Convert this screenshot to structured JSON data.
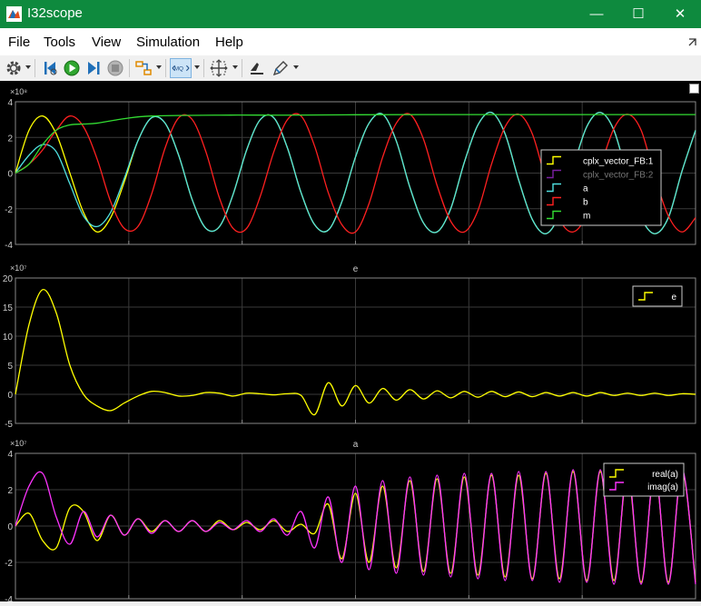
{
  "window": {
    "title": "I32scope",
    "minimize": "—",
    "maximize": "☐",
    "close": "✕"
  },
  "menu": [
    {
      "label": "File"
    },
    {
      "label": "Tools"
    },
    {
      "label": "View"
    },
    {
      "label": "Simulation"
    },
    {
      "label": "Help"
    }
  ],
  "toolbar": [
    "settings-icon",
    "step-back-icon",
    "run-icon",
    "step-forward-icon",
    "stop-icon",
    "highlight-signal-icon",
    "zoom-icon",
    "fit-to-view-icon",
    "cursor-measurements-icon",
    "style-icon"
  ],
  "colors": {
    "yellow": "#ffff00",
    "purple": "#7a1fa2",
    "cyan": "#4fe0e0",
    "red": "#ff2020",
    "green": "#33dd33",
    "magenta": "#ff33ff",
    "grid": "#3a3a3a",
    "axis": "#888888"
  },
  "chart_data": [
    {
      "type": "line",
      "title": "",
      "exponent_label": "×10⁸",
      "ylim": [
        -4,
        4
      ],
      "yticks": [
        4,
        2,
        0,
        -2,
        -4
      ],
      "grid": true,
      "legend_position": "right",
      "series": [
        {
          "name": "cplx_vector_FB:1",
          "color": "#ffff00",
          "x": [
            0,
            0.02,
            0.04,
            0.06,
            0.08,
            0.1,
            0.12,
            0.14,
            0.16,
            0.18,
            0.2,
            0.22,
            0.24,
            0.26,
            0.28,
            0.3,
            0.32,
            0.34,
            0.36,
            0.38,
            0.4,
            0.42,
            0.44,
            0.46,
            0.48,
            0.5,
            0.52,
            0.54,
            0.56,
            0.58,
            0.6,
            0.62,
            0.64,
            0.66,
            0.68,
            0.7,
            0.72,
            0.74,
            0.76,
            0.78,
            0.8,
            0.82,
            0.84,
            0.86,
            0.88,
            0.9,
            0.92,
            0.94,
            0.96,
            0.98,
            1.0
          ],
          "y": [
            0,
            2.4,
            3.2,
            2.2,
            0,
            -2.2,
            -3.3,
            -2.5,
            -0.5,
            1.8,
            3.1,
            2.8,
            1.0,
            -1.5,
            -3.1,
            -3.0,
            -1.2,
            1.3,
            3.0,
            3.1,
            1.4,
            -1.1,
            -2.9,
            -3.2,
            -1.6,
            0.9,
            2.8,
            3.3,
            1.8,
            -0.8,
            -2.8,
            -3.3,
            -2.0,
            0.6,
            2.7,
            3.4,
            2.2,
            -0.4,
            -2.6,
            -3.4,
            -2.3,
            0.3,
            2.6,
            3.4,
            2.4,
            -0.2,
            -2.5,
            -3.4,
            -2.5,
            0.1,
            2.4
          ]
        },
        {
          "name": "cplx_vector_FB:2",
          "color": "#7a1fa2",
          "x": [],
          "y": []
        },
        {
          "name": "a",
          "color": "#4fe0e0",
          "x": [
            0,
            0.02,
            0.04,
            0.06,
            0.08,
            0.1,
            0.12,
            0.14,
            0.16,
            0.18,
            0.2,
            0.22,
            0.24,
            0.26,
            0.28,
            0.3,
            0.32,
            0.34,
            0.36,
            0.38,
            0.4,
            0.42,
            0.44,
            0.46,
            0.48,
            0.5,
            0.52,
            0.54,
            0.56,
            0.58,
            0.6,
            0.62,
            0.64,
            0.66,
            0.68,
            0.7,
            0.72,
            0.74,
            0.76,
            0.78,
            0.8,
            0.82,
            0.84,
            0.86,
            0.88,
            0.9,
            0.92,
            0.94,
            0.96,
            0.98,
            1.0
          ],
          "y": [
            0,
            1.0,
            1.6,
            1.2,
            -0.6,
            -2.4,
            -3.0,
            -2.2,
            -0.3,
            1.8,
            3.1,
            2.8,
            1.0,
            -1.5,
            -3.1,
            -3.0,
            -1.2,
            1.3,
            3.0,
            3.1,
            1.4,
            -1.1,
            -2.9,
            -3.2,
            -1.6,
            0.9,
            2.8,
            3.3,
            1.8,
            -0.8,
            -2.8,
            -3.3,
            -2.0,
            0.6,
            2.7,
            3.4,
            2.2,
            -0.4,
            -2.6,
            -3.4,
            -2.3,
            0.3,
            2.6,
            3.4,
            2.4,
            -0.2,
            -2.5,
            -3.4,
            -2.5,
            0.1,
            2.4
          ]
        },
        {
          "name": "b",
          "color": "#ff2020",
          "x": [
            0,
            0.02,
            0.04,
            0.06,
            0.08,
            0.1,
            0.12,
            0.14,
            0.16,
            0.18,
            0.2,
            0.22,
            0.24,
            0.26,
            0.28,
            0.3,
            0.32,
            0.34,
            0.36,
            0.38,
            0.4,
            0.42,
            0.44,
            0.46,
            0.48,
            0.5,
            0.52,
            0.54,
            0.56,
            0.58,
            0.6,
            0.62,
            0.64,
            0.66,
            0.68,
            0.7,
            0.72,
            0.74,
            0.76,
            0.78,
            0.8,
            0.82,
            0.84,
            0.86,
            0.88,
            0.9,
            0.92,
            0.94,
            0.96,
            0.98,
            1.0
          ],
          "y": [
            0,
            0.5,
            1.3,
            2.4,
            3.2,
            2.6,
            0.8,
            -1.6,
            -3.1,
            -3.0,
            -1.2,
            1.4,
            3.1,
            3.0,
            1.2,
            -1.4,
            -3.1,
            -3.1,
            -1.3,
            1.2,
            3.0,
            3.2,
            1.5,
            -1.1,
            -2.9,
            -3.3,
            -1.7,
            0.9,
            2.8,
            3.3,
            1.9,
            -0.7,
            -2.7,
            -3.3,
            -2.1,
            0.5,
            2.6,
            3.3,
            2.2,
            -0.4,
            -2.6,
            -3.3,
            -2.3,
            0.3,
            2.5,
            3.3,
            2.4,
            -0.2,
            -2.4,
            -3.3,
            -2.5
          ]
        },
        {
          "name": "m",
          "color": "#33dd33",
          "x": [
            0,
            0.02,
            0.04,
            0.06,
            0.08,
            0.1,
            0.12,
            0.16,
            0.2,
            0.3,
            0.4,
            0.5,
            0.6,
            0.7,
            0.8,
            0.9,
            1.0
          ],
          "y": [
            0,
            0.5,
            1.6,
            2.4,
            2.7,
            2.75,
            2.8,
            3.05,
            3.2,
            3.25,
            3.25,
            3.27,
            3.28,
            3.28,
            3.28,
            3.28,
            3.28
          ]
        }
      ]
    },
    {
      "type": "line",
      "title": "e",
      "exponent_label": "×10⁷",
      "ylim": [
        -5,
        20
      ],
      "yticks": [
        20,
        15,
        10,
        5,
        0,
        -5
      ],
      "grid": true,
      "legend_position": "top-right",
      "series": [
        {
          "name": "e",
          "color": "#ffff00",
          "x": [
            0,
            0.02,
            0.04,
            0.06,
            0.08,
            0.1,
            0.12,
            0.14,
            0.16,
            0.18,
            0.2,
            0.22,
            0.24,
            0.26,
            0.28,
            0.3,
            0.32,
            0.34,
            0.36,
            0.38,
            0.4,
            0.42,
            0.44,
            0.46,
            0.48,
            0.5,
            0.52,
            0.54,
            0.56,
            0.58,
            0.6,
            0.62,
            0.64,
            0.66,
            0.68,
            0.7,
            0.72,
            0.74,
            0.76,
            0.78,
            0.8,
            0.82,
            0.84,
            0.86,
            0.88,
            0.9,
            0.92,
            0.94,
            0.96,
            0.98,
            1.0
          ],
          "y": [
            0,
            12,
            18,
            14,
            5,
            0,
            -2,
            -2.8,
            -1.5,
            -0.3,
            0.5,
            0.3,
            -0.3,
            -0.2,
            0.3,
            0.2,
            -0.3,
            0.2,
            0.1,
            -0.1,
            0.1,
            -0.2,
            -3.5,
            2,
            -2,
            1.5,
            -1.5,
            1,
            -1,
            0.8,
            -0.8,
            0.6,
            -0.6,
            0.5,
            -0.5,
            0.5,
            -0.4,
            0.4,
            -0.4,
            0.3,
            -0.3,
            0.3,
            -0.3,
            0.3,
            -0.2,
            0.2,
            -0.2,
            0.2,
            -0.2,
            0.1,
            0
          ]
        }
      ]
    },
    {
      "type": "line",
      "title": "a",
      "exponent_label": "×10⁷",
      "ylim": [
        -4,
        4
      ],
      "yticks": [
        4,
        2,
        0,
        -2,
        -4
      ],
      "grid": true,
      "legend_position": "top-right",
      "series": [
        {
          "name": "real(a)",
          "color": "#ffff00",
          "x": [
            0,
            0.02,
            0.04,
            0.06,
            0.08,
            0.1,
            0.12,
            0.14,
            0.16,
            0.18,
            0.2,
            0.22,
            0.24,
            0.26,
            0.28,
            0.3,
            0.32,
            0.34,
            0.36,
            0.38,
            0.4,
            0.42,
            0.44,
            0.46,
            0.48,
            0.5,
            0.52,
            0.54,
            0.56,
            0.58,
            0.6,
            0.62,
            0.64,
            0.66,
            0.68,
            0.7,
            0.72,
            0.74,
            0.76,
            0.78,
            0.8,
            0.82,
            0.84,
            0.86,
            0.88,
            0.9,
            0.92,
            0.94,
            0.96,
            0.98,
            1.0
          ],
          "y": [
            0,
            0.7,
            -0.8,
            -1.2,
            1,
            0.8,
            -0.8,
            0.6,
            -0.5,
            0.4,
            -0.3,
            0.3,
            -0.3,
            0.3,
            -0.3,
            0.3,
            -0.2,
            0.2,
            -0.2,
            0.3,
            -0.3,
            0.1,
            -0.4,
            1.2,
            -1.8,
            1.8,
            -2,
            2.2,
            -2.3,
            2.5,
            -2.5,
            2.6,
            -2.6,
            2.7,
            -2.7,
            2.8,
            -2.8,
            2.8,
            -2.9,
            2.9,
            -2.9,
            3,
            -3,
            3,
            -3,
            3,
            -3.1,
            3.1,
            -3.1,
            3.1,
            -3.1
          ]
        },
        {
          "name": "imag(a)",
          "color": "#ff33ff",
          "x": [
            0,
            0.02,
            0.04,
            0.06,
            0.08,
            0.1,
            0.12,
            0.14,
            0.16,
            0.18,
            0.2,
            0.22,
            0.24,
            0.26,
            0.28,
            0.3,
            0.32,
            0.34,
            0.36,
            0.38,
            0.4,
            0.42,
            0.44,
            0.46,
            0.48,
            0.5,
            0.52,
            0.54,
            0.56,
            0.58,
            0.6,
            0.62,
            0.64,
            0.66,
            0.68,
            0.7,
            0.72,
            0.74,
            0.76,
            0.78,
            0.8,
            0.82,
            0.84,
            0.86,
            0.88,
            0.9,
            0.92,
            0.94,
            0.96,
            0.98,
            1.0
          ],
          "y": [
            0,
            2.2,
            2.9,
            0.5,
            -1,
            0.8,
            -0.6,
            0.6,
            -0.5,
            0.4,
            -0.4,
            0.3,
            -0.3,
            0.3,
            -0.3,
            0.2,
            -0.2,
            0.3,
            -0.3,
            0.4,
            -0.5,
            0.8,
            -1.2,
            1.6,
            -2,
            2.2,
            -2.4,
            2.5,
            -2.6,
            2.7,
            -2.7,
            2.8,
            -2.8,
            2.9,
            -2.9,
            2.9,
            -3,
            3,
            -3,
            3,
            -3.1,
            3.1,
            -3.1,
            3.1,
            -3.2,
            3.2,
            -3.2,
            3.2,
            -3.2,
            3.2,
            -3.2
          ]
        }
      ]
    }
  ]
}
